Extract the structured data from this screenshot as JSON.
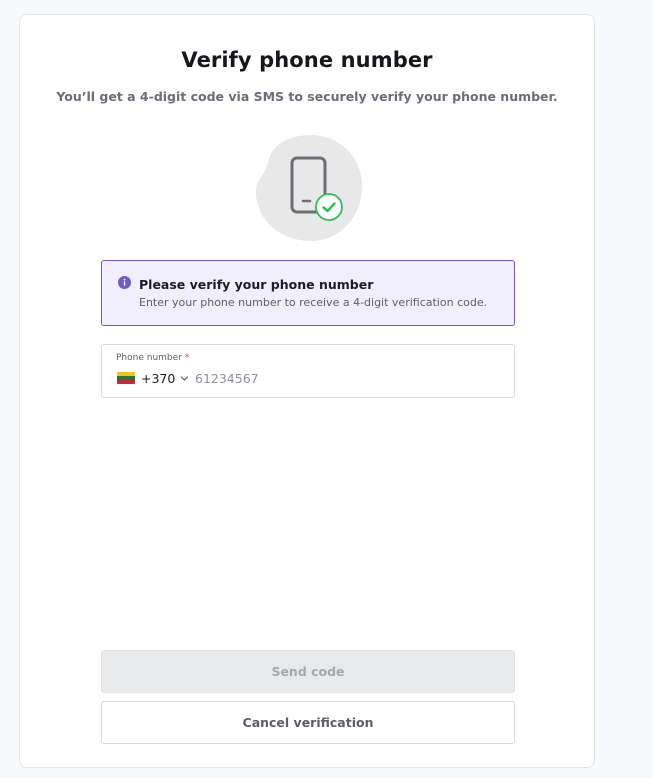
{
  "header": {
    "title": "Verify phone number",
    "subtitle": "You’ll get a 4-digit code via SMS to securely verify your phone number."
  },
  "illustration": {
    "icon": "phone-check-icon",
    "blob_color": "#e8e8e8",
    "phone_color": "#6b6e76",
    "check_color": "#2fbf5b"
  },
  "notice": {
    "icon": "info-icon",
    "title": "Please verify your phone number",
    "text": "Enter your phone number to receive a 4-digit verification code.",
    "accent_color": "#6b5fc4"
  },
  "phone_field": {
    "label": "Phone number",
    "required_marker": "*",
    "country_flag": "lithuania-flag-icon",
    "dial_code": "+370",
    "value": "",
    "placeholder": "61234567"
  },
  "actions": {
    "send_label": "Send code",
    "cancel_label": "Cancel verification"
  }
}
